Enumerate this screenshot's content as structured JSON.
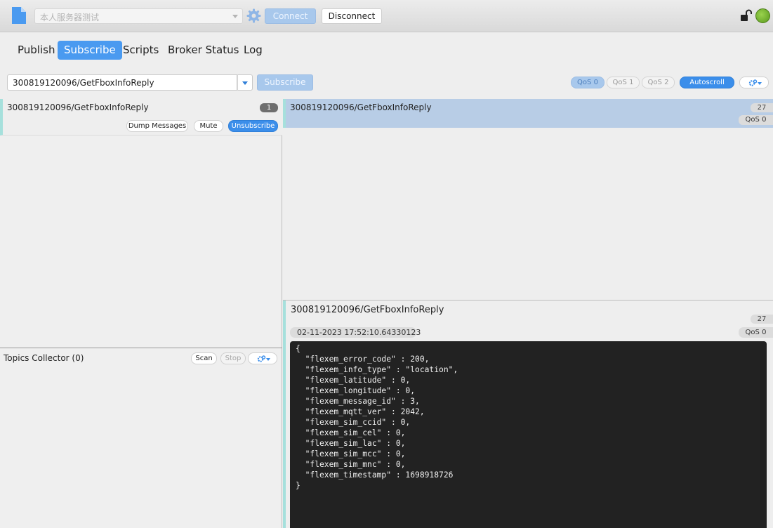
{
  "topbar": {
    "connection_placeholder": "本人服务器测试",
    "connect_label": "Connect",
    "disconnect_label": "Disconnect",
    "status_color": "#6fb02f"
  },
  "tabs": [
    {
      "label": "Publish",
      "active": false
    },
    {
      "label": "Subscribe",
      "active": true
    },
    {
      "label": "Scripts",
      "active": false
    },
    {
      "label": "Broker Status",
      "active": false
    },
    {
      "label": "Log",
      "active": false
    }
  ],
  "subscribe_bar": {
    "topic_value": "300819120096/GetFboxInfoReply",
    "subscribe_label": "Subscribe",
    "qos_options": [
      "QoS 0",
      "QoS 1",
      "QoS 2"
    ],
    "qos_selected": "QoS 0",
    "autoscroll_label": "Autoscroll"
  },
  "subscriptions": [
    {
      "topic": "300819120096/GetFboxInfoReply",
      "count": "1",
      "dump_label": "Dump Messages",
      "mute_label": "Mute",
      "unsubscribe_label": "Unsubscribe"
    }
  ],
  "topics_collector": {
    "label": "Topics Collector (0)",
    "scan_label": "Scan",
    "stop_label": "Stop"
  },
  "messages": [
    {
      "topic": "300819120096/GetFboxInfoReply",
      "number": "27",
      "qos": "QoS 0"
    }
  ],
  "detail": {
    "topic": "300819120096/GetFboxInfoReply",
    "number": "27",
    "timestamp": "02-11-2023  17:52:10.64330123",
    "qos": "QoS 0",
    "payload": "{\n  \"flexem_error_code\" : 200,\n  \"flexem_info_type\" : \"location\",\n  \"flexem_latitude\" : 0,\n  \"flexem_longitude\" : 0,\n  \"flexem_message_id\" : 3,\n  \"flexem_mqtt_ver\" : 2042,\n  \"flexem_sim_ccid\" : 0,\n  \"flexem_sim_cel\" : 0,\n  \"flexem_sim_lac\" : 0,\n  \"flexem_sim_mcc\" : 0,\n  \"flexem_sim_mnc\" : 0,\n  \"flexem_timestamp\" : 1698918726\n}"
  }
}
